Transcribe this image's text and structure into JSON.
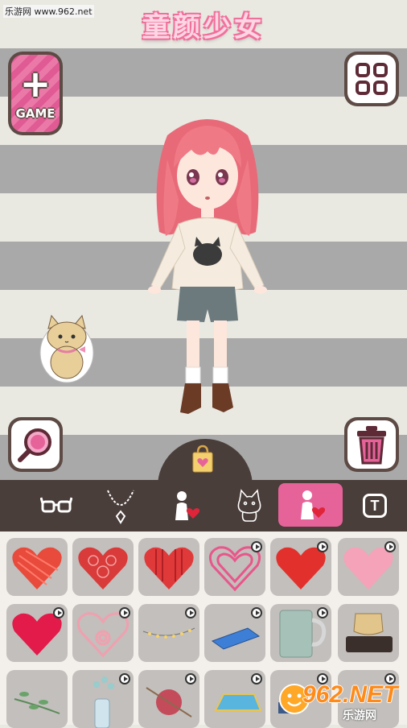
{
  "watermark_top": "乐游网 www.962.net",
  "title": "童颜少女",
  "game_button": {
    "label": "GAME"
  },
  "icons": {
    "game": "plus-icon",
    "menu": "grid-icon",
    "zoom": "magnifier-icon",
    "trash": "trash-icon",
    "bag": "shopping-bag-icon"
  },
  "tabs": [
    {
      "name": "prev-partial",
      "icon": "partial-icon",
      "active": false
    },
    {
      "name": "glasses",
      "icon": "glasses-icon",
      "active": false
    },
    {
      "name": "necklace",
      "icon": "necklace-icon",
      "active": false
    },
    {
      "name": "character-heart",
      "icon": "character-heart-icon",
      "active": false
    },
    {
      "name": "pet",
      "icon": "cat-outline-icon",
      "active": false
    },
    {
      "name": "character-heart-active",
      "icon": "character-heart-icon",
      "active": true
    },
    {
      "name": "text",
      "icon": "text-icon",
      "active": false,
      "label": "T"
    }
  ],
  "items": [
    {
      "name": "red-scribble-heart",
      "locked": false
    },
    {
      "name": "red-lace-heart",
      "locked": false
    },
    {
      "name": "red-striped-heart",
      "locked": false
    },
    {
      "name": "pink-swirl-heart",
      "locked": true
    },
    {
      "name": "red-textured-heart",
      "locked": true
    },
    {
      "name": "pink-soft-heart",
      "locked": true
    },
    {
      "name": "crimson-heart",
      "locked": true
    },
    {
      "name": "pink-outline-heart",
      "locked": true
    },
    {
      "name": "fairy-lights",
      "locked": true
    },
    {
      "name": "blue-pencil-case",
      "locked": true
    },
    {
      "name": "knit-mug",
      "locked": true
    },
    {
      "name": "floor-brush",
      "locked": false
    },
    {
      "name": "green-sprig",
      "locked": false
    },
    {
      "name": "flower-vase",
      "locked": true
    },
    {
      "name": "yarn-ball",
      "locked": true
    },
    {
      "name": "blue-rug",
      "locked": true
    },
    {
      "name": "small-gadget",
      "locked": true
    },
    {
      "name": "partial-item",
      "locked": true
    }
  ],
  "watermark_bottom": {
    "logo": "962.NET",
    "sub": "乐游网"
  },
  "colors": {
    "accent": "#e6639a",
    "dark": "#4a3e3a",
    "frame": "#5d4a45"
  }
}
